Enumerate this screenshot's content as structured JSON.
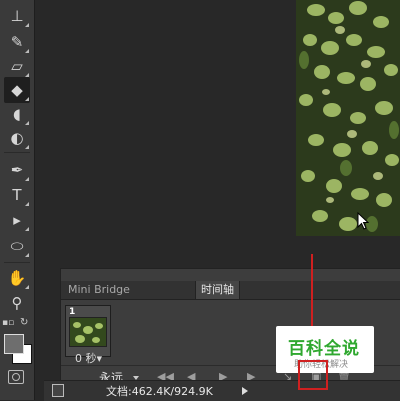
{
  "tools": [
    {
      "name": "stamp-tool-icon",
      "glyph": "⊥",
      "active": false
    },
    {
      "name": "history-brush-tool-icon",
      "glyph": "✎",
      "active": false
    },
    {
      "name": "eraser-tool-icon",
      "glyph": "▱",
      "active": false
    },
    {
      "name": "paint-bucket-tool-icon",
      "glyph": "◆",
      "active": true
    },
    {
      "name": "blur-tool-icon",
      "glyph": "💧",
      "active": false
    },
    {
      "name": "dodge-tool-icon",
      "glyph": "◐",
      "active": false
    },
    {
      "name": "pen-tool-icon",
      "glyph": "✒",
      "active": false
    },
    {
      "name": "type-tool-icon",
      "glyph": "T",
      "active": false
    },
    {
      "name": "path-selection-tool-icon",
      "glyph": "▸",
      "active": false
    },
    {
      "name": "ellipse-tool-icon",
      "glyph": "⬭",
      "active": false
    },
    {
      "name": "hand-tool-icon",
      "glyph": "✋",
      "active": false
    },
    {
      "name": "zoom-tool-icon",
      "glyph": "⚲",
      "active": false
    }
  ],
  "panel": {
    "tabs": {
      "mini_bridge": "Mini Bridge",
      "timeline": "时间轴"
    },
    "frame": {
      "number": "1",
      "delay": "0 秒▾"
    },
    "loop_option": "永远",
    "controls": [
      "first-frame-button",
      "previous-frame-button",
      "play-button",
      "next-frame-button",
      "tween-button",
      "duplicate-frame-button",
      "delete-frame-button"
    ]
  },
  "status_bar": {
    "doc_info": "文档:462.4K/924.9K"
  },
  "watermark": {
    "title": "百科全说",
    "subtitle": "助你轻松解决"
  },
  "colors": {
    "annotation_red": "#cf2020",
    "foreground_swatch": "#6e6e6e",
    "background_swatch": "#ffffff",
    "watermark_green": "#2fa82f"
  }
}
